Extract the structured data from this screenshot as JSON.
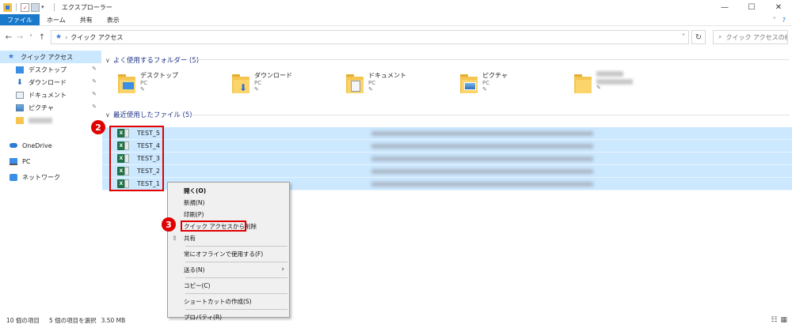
{
  "window": {
    "title": "エクスプローラー",
    "minimize": "—",
    "maximize": "☐",
    "close": "✕"
  },
  "ribbon": {
    "tabs": [
      "ファイル",
      "ホーム",
      "共有",
      "表示"
    ],
    "expand": "˅",
    "help": "?"
  },
  "address": {
    "back": "←",
    "forward": "→",
    "recent": "˅",
    "up": "↑",
    "path": "クイック アクセス",
    "dropdown": "˅",
    "refresh": "↻",
    "search_placeholder": "クイック アクセスの検...",
    "search_icon": "⌕"
  },
  "nav": {
    "quick_access": "クイック アクセス",
    "items": [
      {
        "label": "デスクトップ",
        "icon": "desktop-icon",
        "pinned": true
      },
      {
        "label": "ダウンロード",
        "icon": "download-icon",
        "pinned": true
      },
      {
        "label": "ドキュメント",
        "icon": "document-icon",
        "pinned": true
      },
      {
        "label": "ピクチャ",
        "icon": "picture-icon",
        "pinned": true
      },
      {
        "label": "",
        "icon": "folder-icon",
        "pinned": false
      }
    ],
    "onedrive": "OneDrive",
    "pc": "PC",
    "network": "ネットワーク",
    "pin_glyph": "📌"
  },
  "frequent": {
    "header": "よく使用するフォルダー (5)",
    "tiles": [
      {
        "name": "デスクトップ",
        "sub": "PC",
        "icon": "desktop-folder-icon"
      },
      {
        "name": "ダウンロード",
        "sub": "PC",
        "icon": "download-folder-icon"
      },
      {
        "name": "ドキュメント",
        "sub": "PC",
        "icon": "document-folder-icon"
      },
      {
        "name": "ピクチャ",
        "sub": "PC",
        "icon": "picture-folder-icon"
      },
      {
        "name": "",
        "sub": "",
        "icon": "folder-icon"
      }
    ]
  },
  "recent": {
    "header": "最近使用したファイル (5)",
    "files": [
      "TEST_5",
      "TEST_4",
      "TEST_3",
      "TEST_2",
      "TEST_1"
    ],
    "icon_letter": "X"
  },
  "badges": {
    "two": "2",
    "three": "3"
  },
  "context_menu": {
    "open": "開く(O)",
    "new": "新規(N)",
    "print": "印刷(P)",
    "remove_quick_access": "クイック アクセスから削除",
    "share": "共有",
    "offline": "常にオフラインで使用する(F)",
    "send_to": "送る(N)",
    "copy": "コピー(C)",
    "shortcut": "ショートカットの作成(S)",
    "properties": "プロパティ(R)",
    "submenu_arrow": "›"
  },
  "status": {
    "count": "10 個の項目",
    "selected": "5 個の項目を選択",
    "size": "3.50 MB",
    "details_view": "☷",
    "tiles_view": "▦"
  }
}
